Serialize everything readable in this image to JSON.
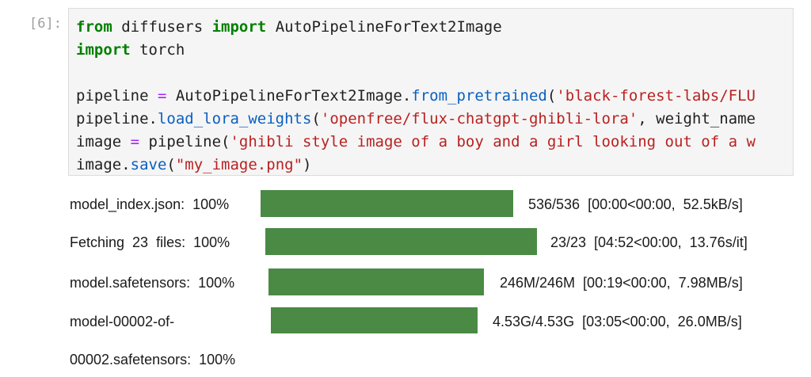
{
  "cell": {
    "prompt": "[6]:",
    "code_lines": [
      [
        {
          "t": "from",
          "c": "kw"
        },
        {
          "t": " diffusers "
        },
        {
          "t": "import",
          "c": "kw"
        },
        {
          "t": " AutoPipelineForText2Image"
        }
      ],
      [
        {
          "t": "import",
          "c": "kw"
        },
        {
          "t": " torch"
        }
      ],
      [],
      [
        {
          "t": "pipeline "
        },
        {
          "t": "=",
          "c": "op"
        },
        {
          "t": " AutoPipelineForText2Image."
        },
        {
          "t": "from_pretrained",
          "c": "fn"
        },
        {
          "t": "("
        },
        {
          "t": "'black-forest-labs/FLU",
          "c": "str"
        }
      ],
      [
        {
          "t": "pipeline."
        },
        {
          "t": "load_lora_weights",
          "c": "fn"
        },
        {
          "t": "("
        },
        {
          "t": "'openfree/flux-chatgpt-ghibli-lora'",
          "c": "str"
        },
        {
          "t": ", weight_name"
        }
      ],
      [
        {
          "t": "image "
        },
        {
          "t": "=",
          "c": "op"
        },
        {
          "t": " pipeline("
        },
        {
          "t": "'ghibli style image of a boy and a girl looking out of a w",
          "c": "str"
        }
      ],
      [
        {
          "t": "image."
        },
        {
          "t": "save",
          "c": "fn"
        },
        {
          "t": "("
        },
        {
          "t": "\"my_image.png\"",
          "c": "str"
        },
        {
          "t": ")"
        }
      ]
    ]
  },
  "output": {
    "bar_color": "#4a8a44",
    "rows": [
      {
        "label": "model_index.json:  100%",
        "progress": 1.0,
        "stats": "536/536  [00:00<00:00,  52.5kB/s]"
      },
      {
        "label": "Fetching  23  files:  100%",
        "progress": 1.0,
        "stats": "23/23  [04:52<00:00,  13.76s/it]"
      },
      {
        "label": "model.safetensors:  100%",
        "progress": 1.0,
        "stats": "246M/246M  [00:19<00:00,  7.98MB/s]"
      },
      {
        "label": "model-00002-of-\n\n00002.safetensors:  100%",
        "progress": 1.0,
        "stats": "4.53G/4.53G  [03:05<00:00,  26.0MB/s]"
      }
    ]
  }
}
